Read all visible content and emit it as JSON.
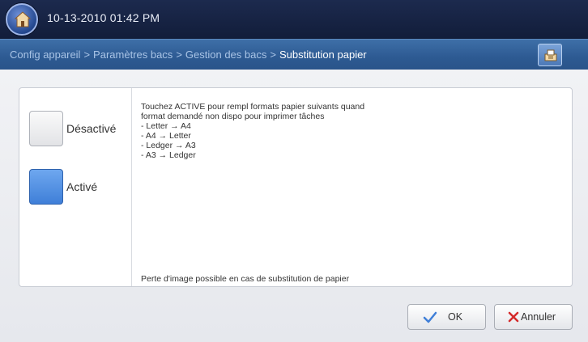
{
  "status_bar": {
    "datetime": "10-13-2010 01:42 PM",
    "home_icon": "home-icon"
  },
  "breadcrumb": {
    "items": [
      "Config appareil",
      "Paramètres bacs",
      "Gestion des bacs"
    ],
    "current": "Substitution papier",
    "separator": ">",
    "job_icon": "job-status-icon"
  },
  "options": {
    "off_label": "Désactivé",
    "on_label": "Activé",
    "selected": "Activé"
  },
  "description": {
    "lines": [
      "Touchez ACTIVE pour rempl formats papier suivants quand",
      "format demandé non dispo pour imprimer tâches",
      "- Letter → A4",
      "- A4 → Letter",
      "- Ledger → A3",
      "- A3 → Ledger"
    ],
    "note": "Perte d'image possible en cas de substitution de papier"
  },
  "buttons": {
    "ok_label": "OK",
    "cancel_label": "Annuler"
  },
  "colors": {
    "accent": "#4a86dc",
    "check": "#3f7fd8",
    "cancel_x": "#d42a2a"
  }
}
